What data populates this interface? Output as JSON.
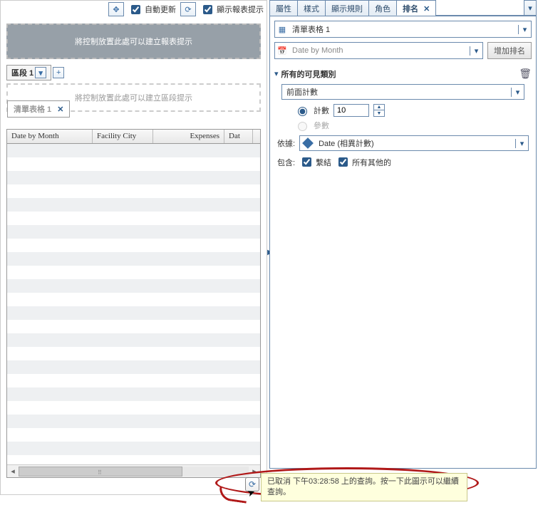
{
  "toolbar": {
    "auto_update": "自動更新",
    "show_prompt": "顯示報表提示"
  },
  "drop_report": "將控制放置此處可以建立報表提示",
  "region_tab": "區段 1",
  "drop_section": "將控制放置此處可以建立區段提示",
  "list_tab": "清單表格 1",
  "grid": {
    "col1": "Date by Month",
    "col2": "Facility City",
    "col3": "Expenses",
    "col4": "Dat"
  },
  "rp_tabs": {
    "t0": "屬性",
    "t1": "樣式",
    "t2": "顯示規則",
    "t3": "角色",
    "t4": "排名"
  },
  "rp": {
    "list_select": "清單表格 1",
    "date_select": "Date by Month",
    "add_rank": "增加排名",
    "all_visible": "所有的可見類別",
    "front_count": "前面計數",
    "count_label": "計數",
    "count_value": "10",
    "param_label": "參數",
    "basis_label": "依據:",
    "basis_value": "Date (相異計數)",
    "include_label": "包含:",
    "ties": "繫結",
    "all_others": "所有其他的"
  },
  "status": "已取消 下午03:28:58 上的查詢。按一下此圖示可以繼續查詢。"
}
